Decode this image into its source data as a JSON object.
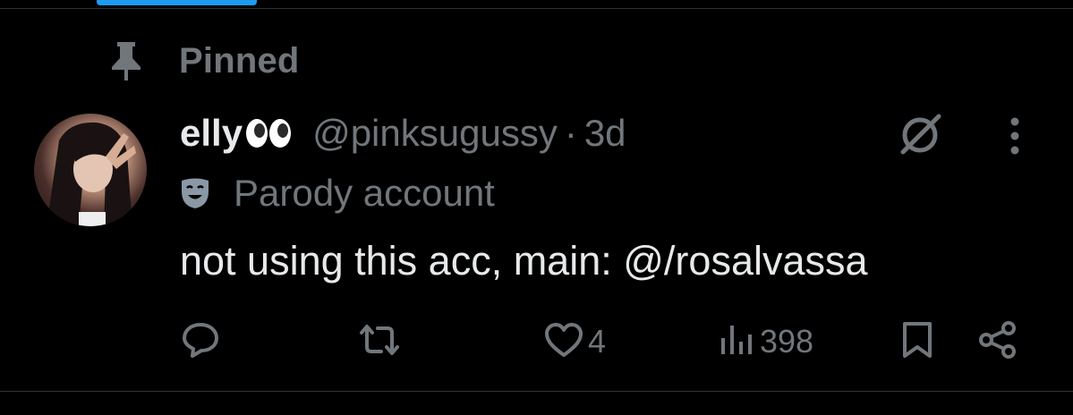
{
  "pinned": {
    "label": "Pinned"
  },
  "tweet": {
    "display_name": "elly",
    "name_emoji": "eyes",
    "handle": "@pinksugussy",
    "separator": "·",
    "time": "3d",
    "account_label": "Parody account",
    "text": "not using this acc, main: @/rosalvassa"
  },
  "actions": {
    "likes": "4",
    "views": "398"
  },
  "colors": {
    "background": "#000000",
    "text_primary": "#e7e9ea",
    "text_secondary": "#71767b",
    "accent": "#1d9bf0",
    "divider": "#2f3336"
  },
  "icons": [
    "pin-icon",
    "eyes-emoji-icon",
    "parody-mask-icon",
    "grok-icon",
    "more-icon",
    "reply-icon",
    "retweet-icon",
    "like-icon",
    "views-icon",
    "bookmark-icon",
    "share-icon"
  ]
}
